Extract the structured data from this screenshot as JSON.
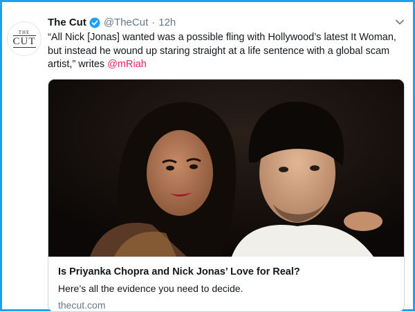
{
  "tweet": {
    "author_name": "The Cut",
    "handle": "@TheCut",
    "separator": "·",
    "time": "12h",
    "avatar_logo": {
      "top": "THE",
      "bottom": "CUT"
    },
    "text": "“All Nick [Jonas] wanted was a possible fling with Hollywood’s latest It Woman, but instead he wound up staring straight at a life sentence with a global scam artist,” writes ",
    "mention": "@mRiah",
    "icons": {
      "verified": "verified-badge-icon",
      "menu": "chevron-down-icon"
    }
  },
  "card": {
    "title": "Is Priyanka Chopra and Nick Jonas’ Love for Real?",
    "description": "Here’s all the evidence you need to decide.",
    "domain": "thecut.com"
  },
  "colors": {
    "frame_border": "#1da1f2",
    "verified": "#1da1f2",
    "mention": "#e0245e",
    "secondary_text": "#657786",
    "primary_text": "#14171a"
  }
}
